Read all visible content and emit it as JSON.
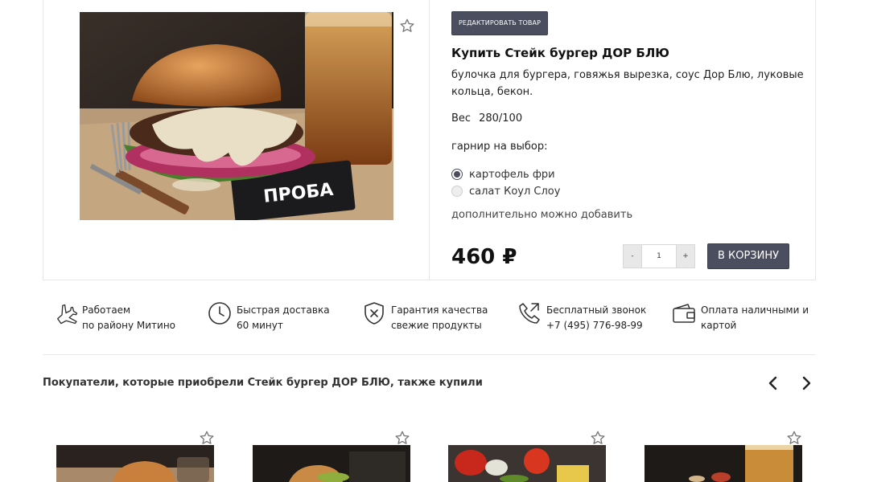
{
  "product": {
    "edit_label": "РЕДАКТИРОВАТЬ ТОВАР",
    "title": "Купить Стейк бургер ДОР БЛЮ",
    "description": "булочка для бургера, говяжья вырезка, соус Дор Блю, луковые кольца, бекон.",
    "weight_label": "Вес",
    "weight_value": "280/100",
    "garnish_label": "гарнир на выбор:",
    "garnish_options": [
      {
        "label": "картофель фри",
        "selected": true
      },
      {
        "label": "салат Коул Слоу",
        "selected": false
      }
    ],
    "extra_label": "дополнительно можно добавить",
    "price": "460 ₽",
    "qty_minus": "-",
    "qty_value": "1",
    "qty_plus": "+",
    "cart_label": "В КОРЗИНУ",
    "photo_icon": "burger-photo"
  },
  "features": [
    {
      "icon": "airplane-icon",
      "line1": "Работаем",
      "line2": "по району Митино"
    },
    {
      "icon": "clock-icon",
      "line1": "Быстрая доставка",
      "line2": "60 минут"
    },
    {
      "icon": "shield-icon",
      "line1": "Гарантия качества",
      "line2": "свежие продукты"
    },
    {
      "icon": "phone-icon",
      "line1": "Бесплатный звонок",
      "line2": "+7 (495) 776-98-99"
    },
    {
      "icon": "wallet-icon",
      "line1": "Оплата наличными и",
      "line2": "картой"
    }
  ],
  "also_bought": {
    "title": "Покупатели, которые приобрели Стейк бургер ДОР БЛЮ, также купили",
    "items": [
      {
        "photo": "burger-photo"
      },
      {
        "photo": "burger-photo"
      },
      {
        "photo": "vegetables-platter-photo"
      },
      {
        "photo": "beer-photo"
      }
    ]
  },
  "colors": {
    "accent": "#4a4e5e",
    "border": "#e6e6e6"
  }
}
